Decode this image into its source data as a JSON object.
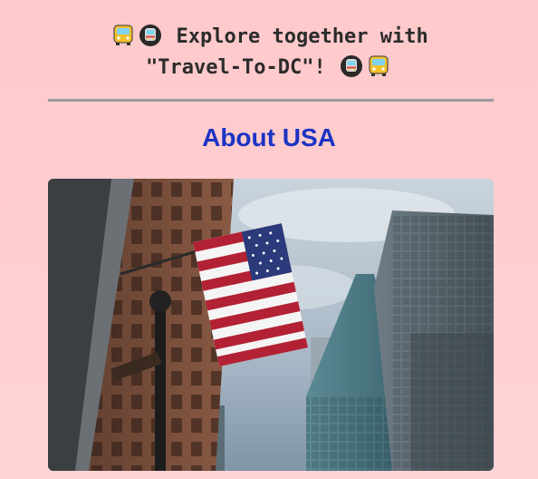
{
  "header": {
    "line1_text": "Explore together with",
    "line2_text": "\"Travel-To-DC\"!",
    "icons": [
      "bus-icon",
      "metro-icon",
      "metro-icon",
      "bus-icon"
    ]
  },
  "section": {
    "title": "About USA"
  },
  "photo": {
    "subject": "us-flag-between-skyscrapers-photo"
  },
  "colors": {
    "background": "#ffc9cb",
    "title": "#1b33c4",
    "divider": "#999a9e"
  }
}
